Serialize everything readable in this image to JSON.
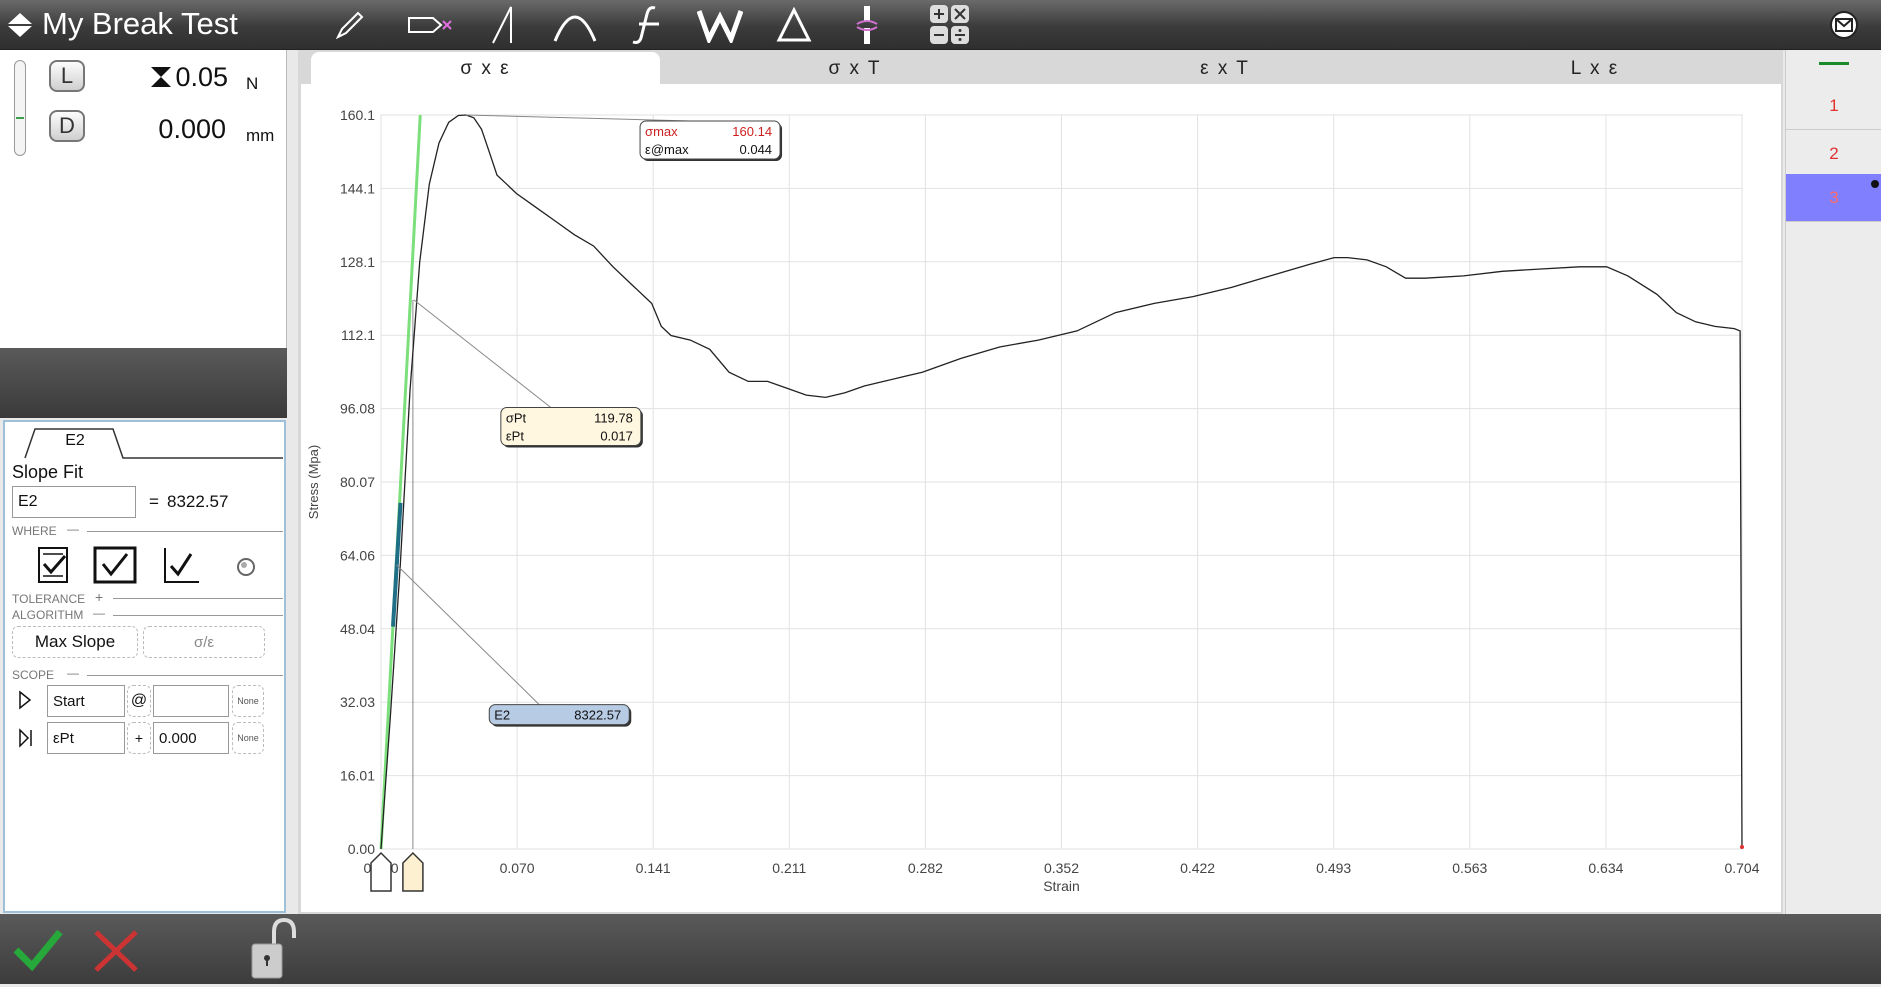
{
  "app": {
    "title": "My Break Test"
  },
  "readout": {
    "load": {
      "key": "L",
      "value": "0.05",
      "unit": "N"
    },
    "displacement": {
      "key": "D",
      "value": "0.000",
      "unit": "mm"
    }
  },
  "params": {
    "tab": "E2",
    "section_title": "Slope Fit",
    "name_value": "E2",
    "equals_label": "=",
    "result": "8322.57",
    "where_label": "WHERE",
    "tolerance_label": "TOLERANCE",
    "algorithm_label": "ALGORITHM",
    "algorithm_option": "Max Slope",
    "algorithm_option2": "σ/ε",
    "scope_label": "SCOPE",
    "scope_start": {
      "value": "Start",
      "op": "@",
      "extra": "",
      "none": "None"
    },
    "scope_end": {
      "value": "εPt",
      "op": "+",
      "extra": "0.000",
      "none": "None"
    },
    "minus": "—",
    "plus": "+"
  },
  "chart_tabs": [
    "σ x ε",
    "σ x T",
    "ε x T",
    "L x ε"
  ],
  "sample_list": [
    "1",
    "2",
    "3"
  ],
  "colors": {
    "accent_selected": "#8080ff",
    "curve": "#222222",
    "fit_line": "#7be07b",
    "fit_segment": "#1f6f86",
    "sample_red": "#e03030"
  },
  "chart_data": {
    "type": "line",
    "xlabel": "Strain",
    "ylabel": "Stress (Mpa)",
    "xlim": [
      0.0,
      0.704
    ],
    "ylim": [
      0.0,
      160.1
    ],
    "xticks": [
      "0.000",
      "0.070",
      "0.141",
      "0.211",
      "0.282",
      "0.352",
      "0.422",
      "0.493",
      "0.563",
      "0.634",
      "0.704"
    ],
    "yticks": [
      "0.00",
      "16.01",
      "32.03",
      "48.04",
      "64.06",
      "80.07",
      "96.08",
      "112.1",
      "128.1",
      "144.1",
      "160.1"
    ],
    "grid": true,
    "series": [
      {
        "x": [
          0.0,
          0.005,
          0.01,
          0.015,
          0.02,
          0.025,
          0.03,
          0.035,
          0.04,
          0.044,
          0.048,
          0.052,
          0.056,
          0.06,
          0.065,
          0.07,
          0.08,
          0.09,
          0.1,
          0.11,
          0.12,
          0.13,
          0.14,
          0.145,
          0.15,
          0.16,
          0.17,
          0.18,
          0.19,
          0.2,
          0.21,
          0.22,
          0.23,
          0.24,
          0.25,
          0.26,
          0.27,
          0.28,
          0.3,
          0.32,
          0.34,
          0.36,
          0.38,
          0.4,
          0.42,
          0.44,
          0.46,
          0.48,
          0.493,
          0.5,
          0.51,
          0.52,
          0.53,
          0.54,
          0.56,
          0.58,
          0.6,
          0.62,
          0.634,
          0.645,
          0.66,
          0.67,
          0.68,
          0.69,
          0.7,
          0.703,
          0.704
        ],
        "y": [
          0.0,
          30.0,
          62.0,
          100.0,
          128.0,
          145.0,
          154.0,
          158.5,
          160.0,
          160.1,
          159.5,
          157.0,
          152.0,
          147.0,
          145.0,
          143.0,
          140.0,
          137.0,
          134.0,
          131.5,
          127.0,
          123.0,
          119.0,
          114.0,
          112.0,
          111.0,
          109.0,
          104.0,
          102.0,
          102.0,
          100.5,
          99.0,
          98.5,
          99.5,
          101.0,
          102.0,
          103.0,
          104.0,
          107.0,
          109.5,
          111.0,
          113.0,
          117.0,
          119.0,
          120.5,
          122.5,
          125.0,
          127.5,
          129.0,
          129.0,
          128.5,
          127.0,
          124.5,
          124.5,
          125.0,
          126.0,
          126.5,
          127.0,
          127.0,
          125.0,
          121.0,
          117.0,
          115.0,
          114.0,
          113.5,
          113.0,
          0.0
        ]
      }
    ],
    "annotations": [
      {
        "label1": "σmax",
        "value1": "160.14",
        "label2": "ε@max",
        "value2": "0.044",
        "x": 0.044,
        "y": 160.1
      },
      {
        "label1": "σPt",
        "value1": "119.78",
        "label2": "εPt",
        "value2": "0.017",
        "x": 0.017,
        "y": 119.78
      },
      {
        "label1": "E2",
        "value1": "8322.57",
        "x": 0.008,
        "y": 62.0
      }
    ]
  }
}
